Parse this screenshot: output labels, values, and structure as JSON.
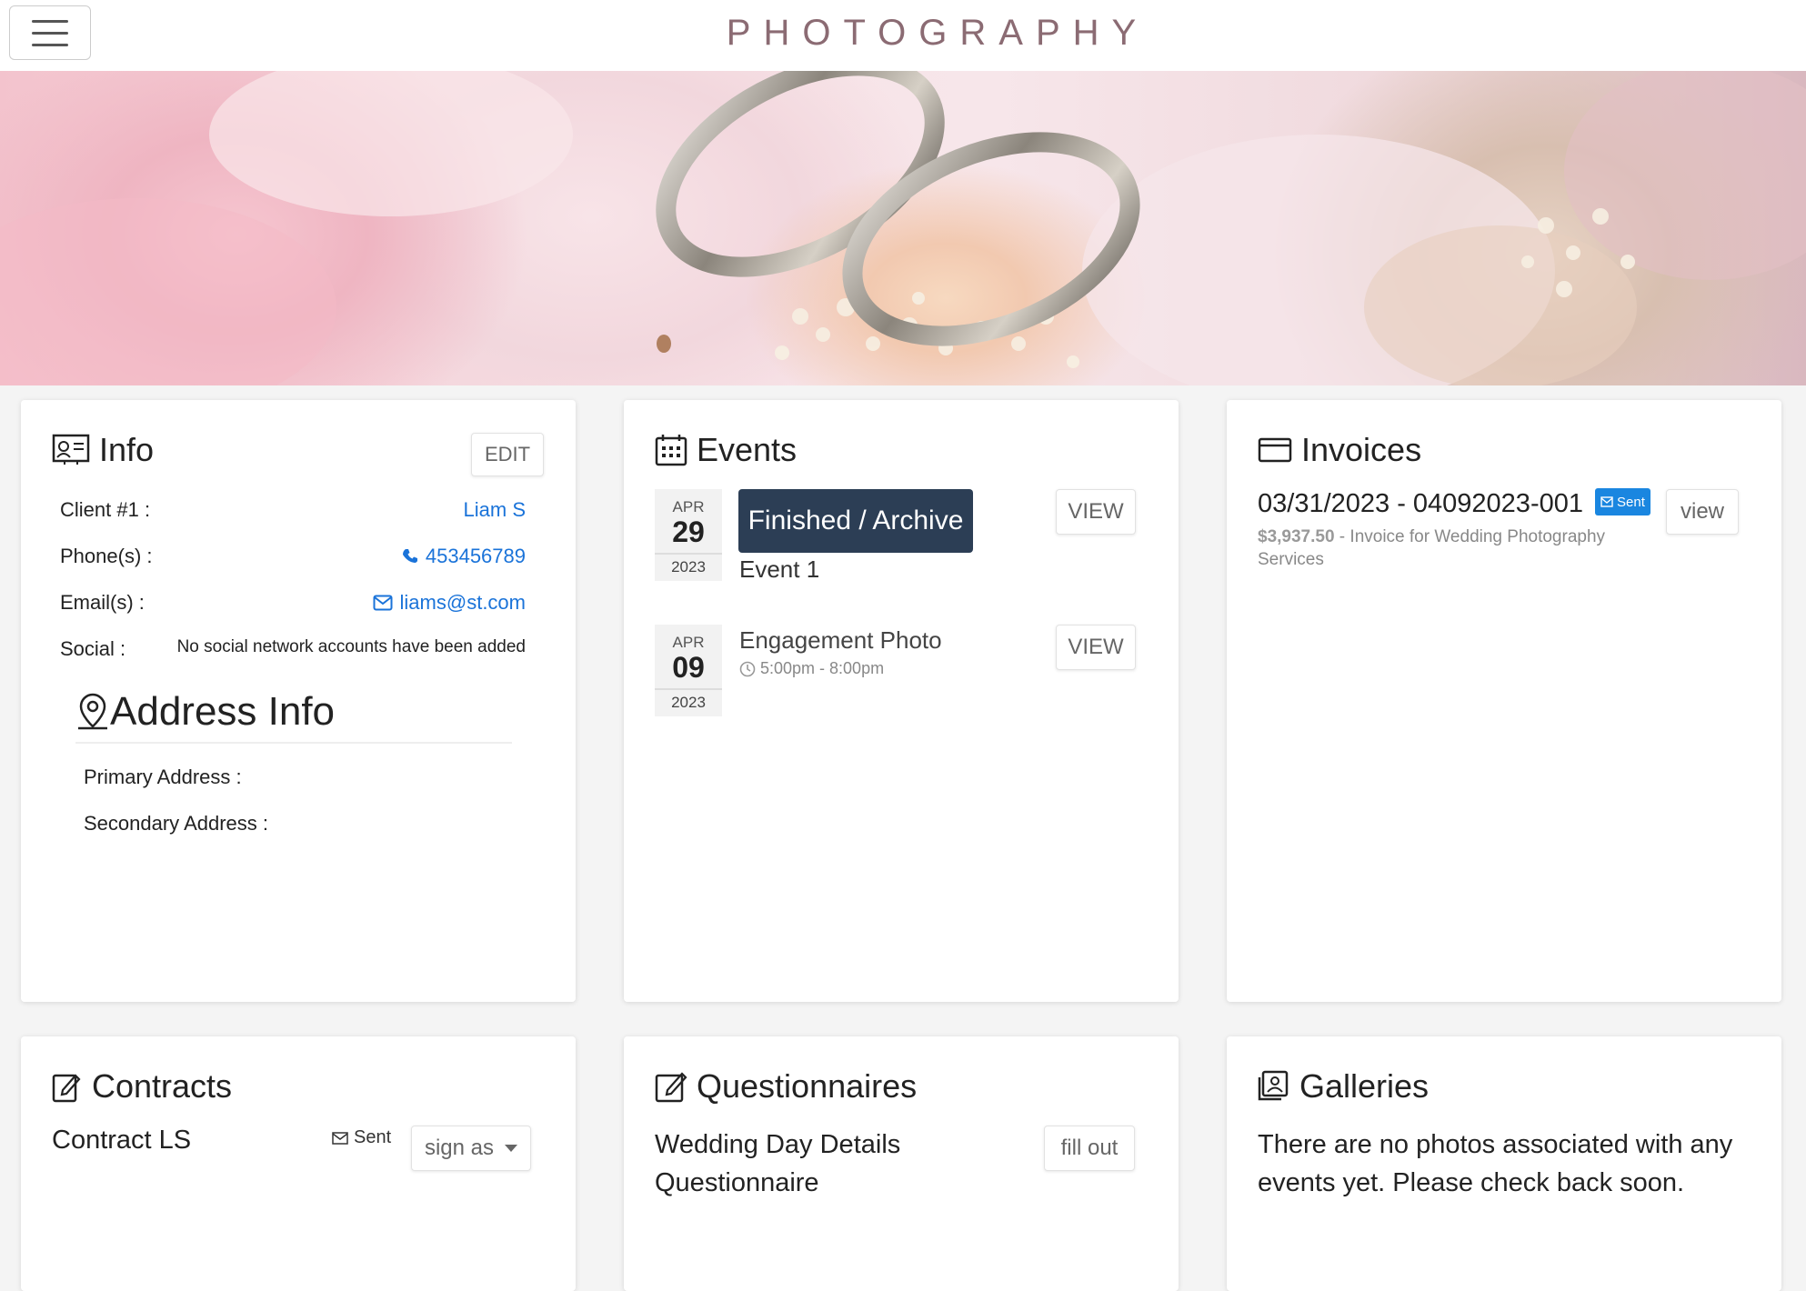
{
  "header": {
    "brand": "PHOTOGRAPHY",
    "menu_icon": "hamburger-icon"
  },
  "info": {
    "title": "Info",
    "edit_label": "EDIT",
    "client_label": "Client #1 :",
    "client_value": "Liam S",
    "phone_label": "Phone(s) :",
    "phone_value": "453456789",
    "email_label": "Email(s) :",
    "email_value": "liams@st.com",
    "social_label": "Social :",
    "social_value": "No social network accounts have been added",
    "address_title": "Address Info",
    "primary_address_label": "Primary Address :",
    "secondary_address_label": "Secondary Address :"
  },
  "events": {
    "title": "Events",
    "items": [
      {
        "month": "APR",
        "day": "29",
        "year": "2023",
        "status": "Finished / Archive",
        "name": "Event 1",
        "time": "",
        "view_label": "VIEW"
      },
      {
        "month": "APR",
        "day": "09",
        "year": "2023",
        "status": "",
        "name": "Engagement Photo",
        "time": "5:00pm - 8:00pm",
        "view_label": "VIEW"
      }
    ]
  },
  "invoices": {
    "title": "Invoices",
    "items": [
      {
        "heading": "03/31/2023 - 04092023-001",
        "badge": "Sent",
        "amount": "$3,937.50",
        "description": " - Invoice for Wedding Photography Services",
        "view_label": "view"
      }
    ]
  },
  "contracts": {
    "title": "Contracts",
    "items": [
      {
        "name": "Contract LS",
        "status": "Sent",
        "action_label": "sign as"
      }
    ]
  },
  "questionnaires": {
    "title": "Questionnaires",
    "items": [
      {
        "name": "Wedding Day Details Questionnaire",
        "action_label": "fill out"
      }
    ]
  },
  "galleries": {
    "title": "Galleries",
    "empty_message": "There are no photos associated with any events yet. Please check back soon."
  },
  "colors": {
    "accent_link": "#1a73d9",
    "status_pill": "#2c3e55",
    "sent_badge": "#1a86e0",
    "brand_text": "#8b6b73"
  }
}
